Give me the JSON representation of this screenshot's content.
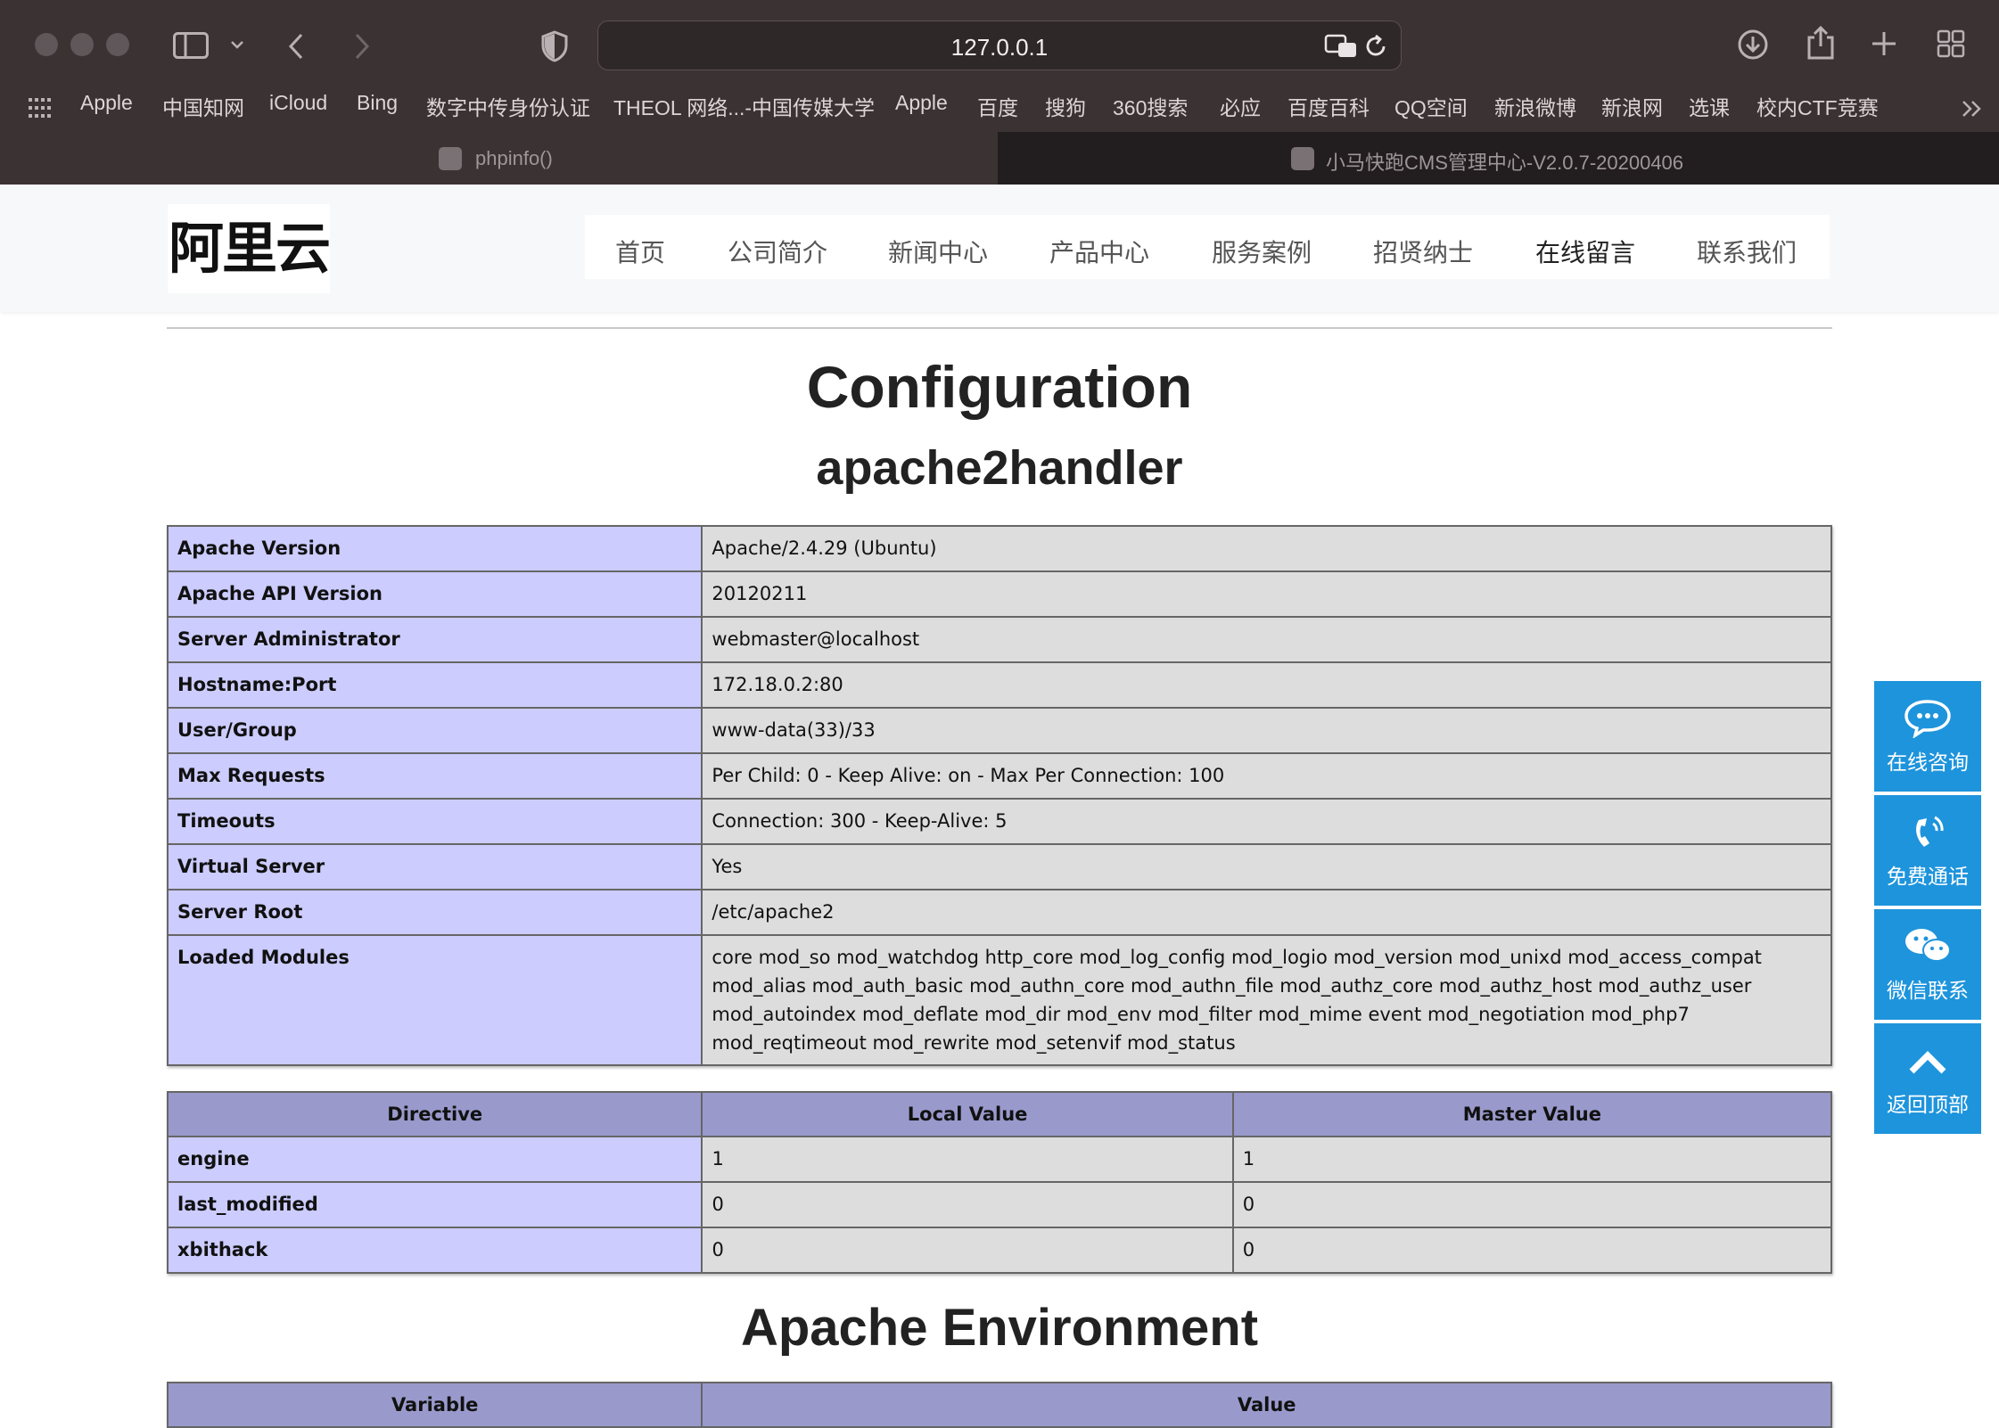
{
  "browser": {
    "url": "127.0.0.1",
    "bookmarks": [
      "Apple",
      "中国知网",
      "iCloud",
      "Bing",
      "数字中传身份认证",
      "THEOL 网络...-中国传媒大学",
      "Apple",
      "百度",
      "搜狗",
      "360搜索",
      "必应",
      "百度百科",
      "QQ空间",
      "新浪微博",
      "新浪网",
      "选课",
      "校内CTF竞赛"
    ],
    "tabs": [
      {
        "label": "phpinfo()",
        "active": false
      },
      {
        "label": "小马快跑CMS管理中心-V2.0.7-20200406",
        "active": true
      }
    ]
  },
  "site": {
    "logo": "阿里云",
    "nav": [
      "首页",
      "公司简介",
      "新闻中心",
      "产品中心",
      "服务案例",
      "招贤纳士",
      "在线留言",
      "联系我们"
    ],
    "nav_active": "在线留言"
  },
  "content": {
    "title": "Configuration",
    "subtitle": "apache2handler",
    "info_rows": [
      {
        "key": "Apache Version",
        "value": "Apache/2.4.29 (Ubuntu)"
      },
      {
        "key": "Apache API Version",
        "value": "20120211"
      },
      {
        "key": "Server Administrator",
        "value": "webmaster@localhost"
      },
      {
        "key": "Hostname:Port",
        "value": "172.18.0.2:80"
      },
      {
        "key": "User/Group",
        "value": "www-data(33)/33"
      },
      {
        "key": "Max Requests",
        "value": "Per Child: 0 - Keep Alive: on - Max Per Connection: 100"
      },
      {
        "key": "Timeouts",
        "value": "Connection: 300 - Keep-Alive: 5"
      },
      {
        "key": "Virtual Server",
        "value": "Yes"
      },
      {
        "key": "Server Root",
        "value": "/etc/apache2"
      },
      {
        "key": "Loaded Modules",
        "value": "core mod_so mod_watchdog http_core mod_log_config mod_logio mod_version mod_unixd mod_access_compat mod_alias mod_auth_basic mod_authn_core mod_authn_file mod_authz_core mod_authz_host mod_authz_user mod_autoindex mod_deflate mod_dir mod_env mod_filter mod_mime event mod_negotiation mod_php7 mod_reqtimeout mod_rewrite mod_setenvif mod_status"
      }
    ],
    "directive_headers": [
      "Directive",
      "Local Value",
      "Master Value"
    ],
    "directives": [
      {
        "name": "engine",
        "local": "1",
        "master": "1"
      },
      {
        "name": "last_modified",
        "local": "0",
        "master": "0"
      },
      {
        "name": "xbithack",
        "local": "0",
        "master": "0"
      }
    ],
    "env_title": "Apache Environment",
    "env_headers": [
      "Variable",
      "Value"
    ]
  },
  "float_bar": [
    {
      "label": "在线咨询",
      "icon": "chat-bubble-icon"
    },
    {
      "label": "免费通话",
      "icon": "phone-icon"
    },
    {
      "label": "微信联系",
      "icon": "wechat-icon"
    },
    {
      "label": "返回顶部",
      "icon": "chevron-up-icon"
    }
  ],
  "colors": {
    "chrome_bg": "#3b3234",
    "key_cell": "#ccccff",
    "value_cell": "#dddddd",
    "header_cell": "#9999cc",
    "float_bar": "#1e94dc"
  }
}
